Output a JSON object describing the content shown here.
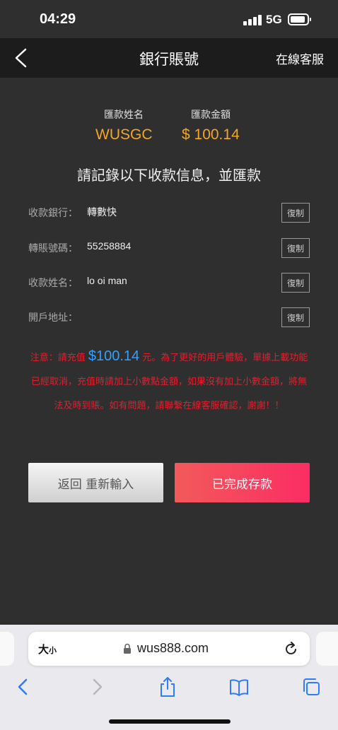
{
  "status_bar": {
    "time": "04:29",
    "network": "5G"
  },
  "nav": {
    "title": "銀行賬號",
    "service_link": "在線客服"
  },
  "summary": {
    "name_label": "匯款姓名",
    "amount_label": "匯款金額",
    "name_value": "WUSGC",
    "amount_value": "$ 100.14"
  },
  "instruction": "請記錄以下收款信息，並匯款",
  "info_rows": [
    {
      "label": "收款銀行：",
      "value": "轉數快",
      "copy": "復制"
    },
    {
      "label": "轉賬號碼：",
      "value": "55258884",
      "copy": "復制"
    },
    {
      "label": "收款姓名：",
      "value": "lo oi man",
      "copy": "復制"
    },
    {
      "label": "開戶地址：",
      "value": "",
      "copy": "復制"
    }
  ],
  "notice": {
    "prefix": "注意：請充值 ",
    "amount": "$100.14",
    "suffix": " 元。為了更好的用戶體驗，單據上載功能已經取消，充值時請加上小數點金額，如果沒有加上小數金額，將無法及時到賬。如有問題，請聯繫在線客服確認，謝謝！！"
  },
  "buttons": {
    "back": "返回 重新輸入",
    "done": "已完成存款"
  },
  "browser": {
    "text_size_label": "大",
    "text_size_small": "小",
    "url": "wus888.com"
  },
  "colors": {
    "accent_amount": "#f5a623",
    "notice_red": "#e0202e",
    "notice_blue": "#33a1ff",
    "done_button": "#fb2d64"
  }
}
